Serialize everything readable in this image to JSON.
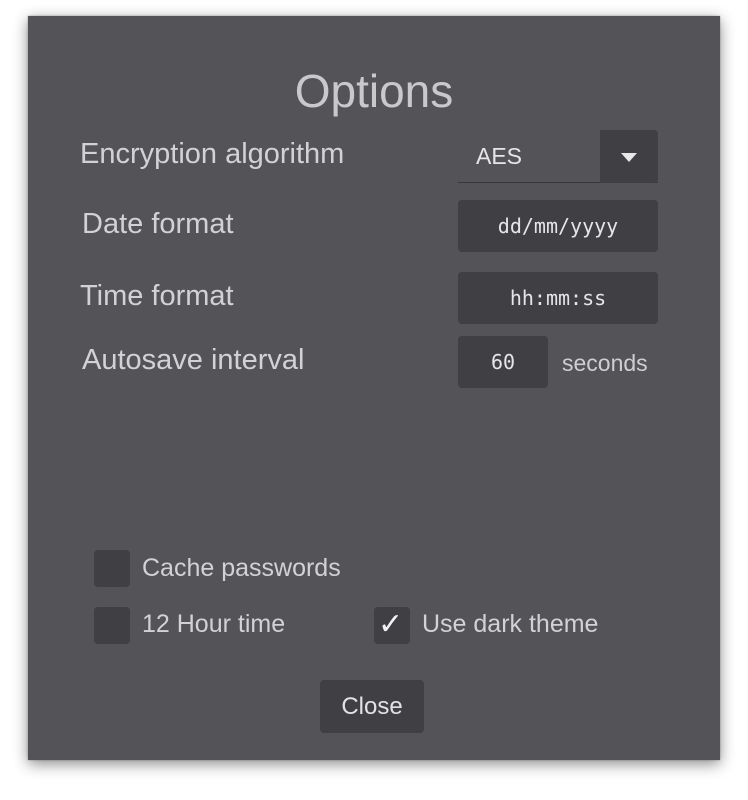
{
  "dialog": {
    "title": "Options"
  },
  "fields": {
    "encryption": {
      "label": "Encryption algorithm",
      "value": "AES"
    },
    "date_format": {
      "label": "Date format",
      "value": "dd/mm/yyyy"
    },
    "time_format": {
      "label": "Time format",
      "value": "hh:mm:ss"
    },
    "autosave": {
      "label": "Autosave interval",
      "value": "60",
      "unit": "seconds"
    }
  },
  "checkboxes": {
    "cache_passwords": {
      "label": "Cache passwords",
      "checked": false
    },
    "hour12": {
      "label": "12 Hour time",
      "checked": false
    },
    "dark_theme": {
      "label": "Use dark theme",
      "checked": true,
      "mark": "✓"
    }
  },
  "buttons": {
    "close_label": "Close"
  },
  "icons": {
    "dropdown": "chevron-down-icon",
    "checked": "checkmark-icon"
  },
  "colors": {
    "panel": "#545358",
    "field": "#3f3f44",
    "text": "#d2d2d6"
  }
}
